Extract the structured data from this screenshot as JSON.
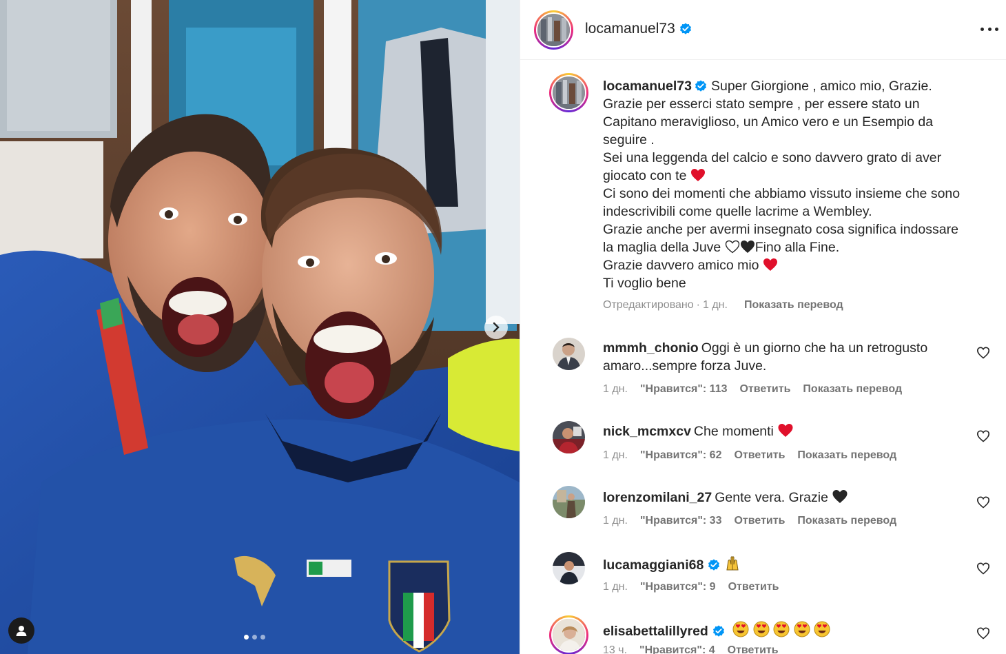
{
  "post": {
    "username": "locamanuel73",
    "more_icon": "more-horizontal-icon",
    "carousel": {
      "count": 3,
      "active": 0
    }
  },
  "caption": {
    "username": "locamanuel73",
    "lines": [
      "Super Giorgione , amico mio, Grazie.",
      "Grazie per esserci stato sempre , per essere stato un",
      "Capitano meraviglioso, un Amico vero e un Esempio da",
      "seguire .",
      "Sei una leggenda del calcio e sono davvero grato di aver",
      "giocato con te",
      "Ci sono dei momenti che abbiamo vissuto insieme che sono",
      "indescrivibili come quelle lacrime a Wembley.",
      "Grazie anche per avermi insegnato cosa significa indossare",
      "la maglia della Juve",
      "Fino alla Fine.",
      "Grazie davvero amico mio",
      "Ti voglio bene"
    ],
    "edited": "Отредактировано",
    "time": "1 дн.",
    "translate": "Показать перевод"
  },
  "comments": [
    {
      "username": "mmmh_chonio",
      "verified": false,
      "text": "Oggi è un giorno che ha un retrogusto amaro...sempre forza Juve.",
      "time": "1 дн.",
      "likes": "\"Нравится\": 113",
      "reply": "Ответить",
      "translate": "Показать перевод"
    },
    {
      "username": "nick_mcmxcv",
      "verified": false,
      "text": "Che momenti",
      "time": "1 дн.",
      "likes": "\"Нравится\": 62",
      "reply": "Ответить",
      "translate": "Показать перевод"
    },
    {
      "username": "lorenzomilani_27",
      "verified": false,
      "text": "Gente vera. Grazie",
      "time": "1 дн.",
      "likes": "\"Нравится\": 33",
      "reply": "Ответить",
      "translate": "Показать перевод"
    },
    {
      "username": "lucamaggiani68",
      "verified": true,
      "text": "",
      "time": "1 дн.",
      "likes": "\"Нравится\": 9",
      "reply": "Ответить",
      "translate": ""
    },
    {
      "username": "elisabettalillyred",
      "verified": true,
      "text": "",
      "time": "13 ч.",
      "likes": "\"Нравится\": 4",
      "reply": "Ответить",
      "translate": ""
    }
  ],
  "colors": {
    "verified": "#0095f6",
    "heart": "#e0102b",
    "meta": "#8e8e8e"
  }
}
